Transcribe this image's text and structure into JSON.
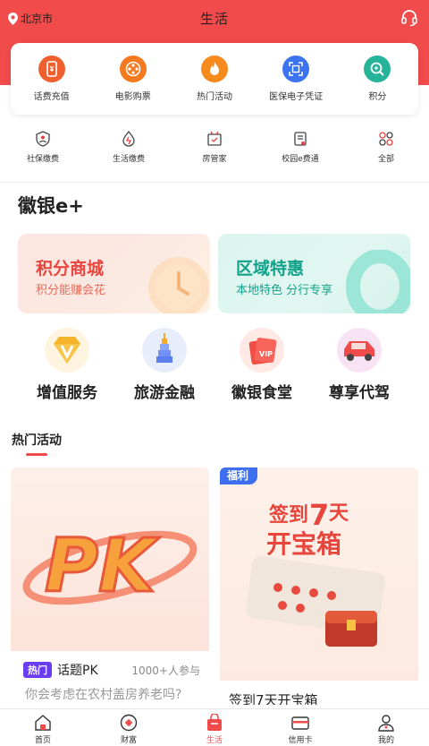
{
  "header": {
    "location": "北京市",
    "title": "生活",
    "service_icon": "headset-icon"
  },
  "quick_services": [
    {
      "label": "话费充值",
      "icon": "phone-recharge-icon",
      "color": "#f0602e"
    },
    {
      "label": "电影购票",
      "icon": "film-reel-icon",
      "color": "#f57a1f"
    },
    {
      "label": "热门活动",
      "icon": "flame-icon",
      "color": "#f78a1c"
    },
    {
      "label": "医保电子凭证",
      "icon": "qr-scan-icon",
      "color": "#3b73f0"
    },
    {
      "label": "积分",
      "icon": "points-icon",
      "color": "#25b39a"
    }
  ],
  "services": [
    {
      "label": "社保缴费",
      "icon": "social-security-icon"
    },
    {
      "label": "生活缴费",
      "icon": "water-drop-icon"
    },
    {
      "label": "房管家",
      "icon": "house-icon"
    },
    {
      "label": "校园e费通",
      "icon": "school-book-icon"
    },
    {
      "label": "全部",
      "icon": "grid-icon"
    }
  ],
  "section": {
    "title": "徽银e+"
  },
  "promos": [
    {
      "title": "积分商城",
      "subtitle": "积分能赚会花"
    },
    {
      "title": "区域特惠",
      "subtitle": "本地特色 分行专享"
    }
  ],
  "categories": [
    {
      "label": "增值服务",
      "icon": "diamond-v-icon"
    },
    {
      "label": "旅游金融",
      "icon": "tower-icon"
    },
    {
      "label": "徽银食堂",
      "icon": "vip-gift-icon"
    },
    {
      "label": "尊享代驾",
      "icon": "car-icon"
    }
  ],
  "hot": {
    "title": "热门活动"
  },
  "activities": [
    {
      "art_text": "PK",
      "badge": "热门",
      "title": "话题PK",
      "count": "1000+人参与",
      "desc": "你会考虑在农村盖房养老吗?"
    },
    {
      "badge": "福利",
      "art_line1_a": "签到",
      "art_line1_b": "7",
      "art_line1_c": "天",
      "art_line2": "开宝箱",
      "title": "签到7天开宝箱"
    }
  ],
  "tabbar": [
    {
      "label": "首页",
      "icon": "home-icon"
    },
    {
      "label": "财富",
      "icon": "wealth-icon"
    },
    {
      "label": "生活",
      "icon": "shopping-bag-icon",
      "active": true
    },
    {
      "label": "信用卡",
      "icon": "credit-card-icon"
    },
    {
      "label": "我的",
      "icon": "user-icon"
    }
  ],
  "colors": {
    "brand": "#f14b4b",
    "gold": "#f5a52a",
    "teal": "#1fb59a"
  }
}
